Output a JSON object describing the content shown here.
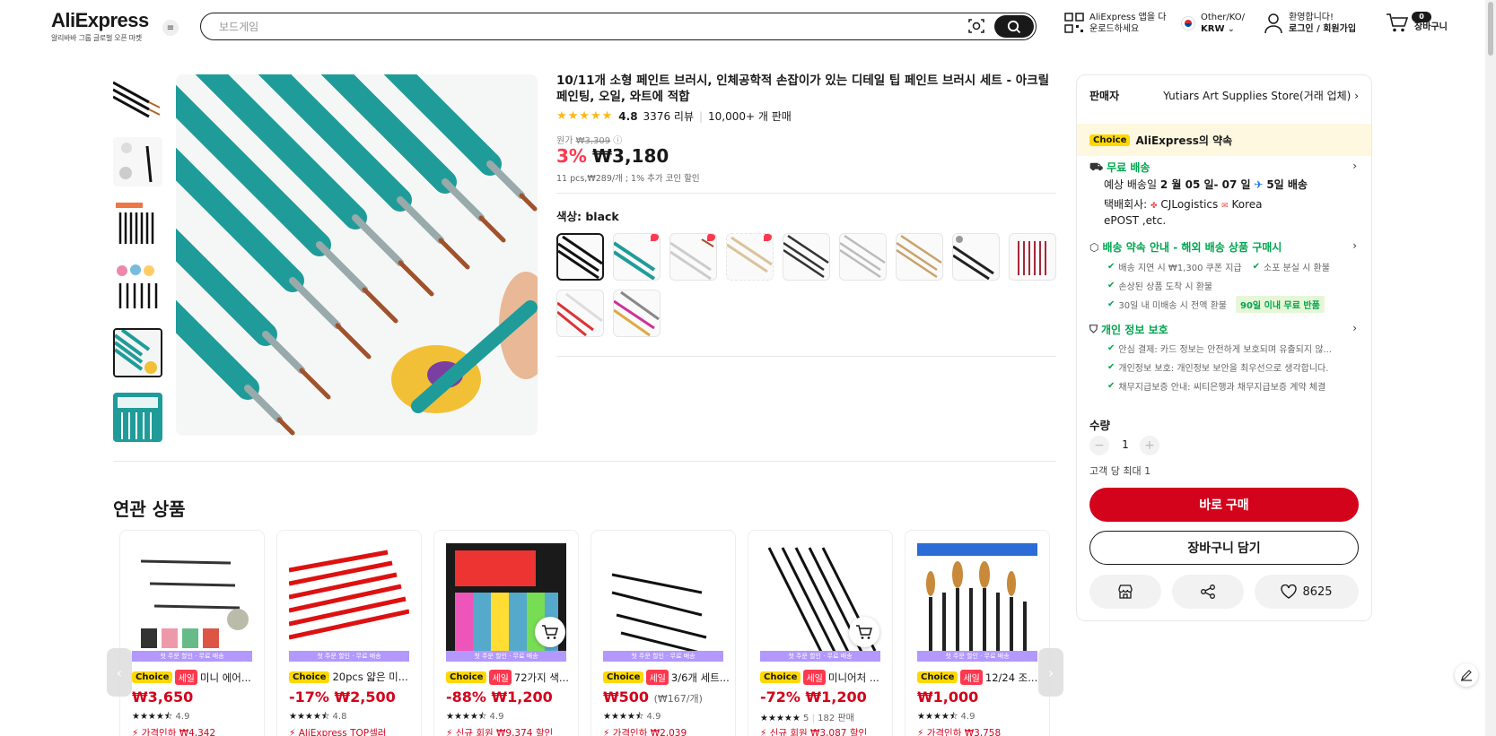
{
  "header": {
    "logo": "AliExpress",
    "logo_sub": "알리바바 그룹 글로벌 오픈 마켓",
    "search_placeholder": "보드게임",
    "app_download_line1": "AliExpress 앱을 다",
    "app_download_line2": "운로드하세요",
    "locale_line1": "Other/KO/",
    "locale_line2": "KRW",
    "account_line1": "환영합니다!",
    "account_line2": "로그인 / 회원가입",
    "cart_count": "0",
    "cart_label": "장바구니"
  },
  "product": {
    "title": "10/11개 소형 페인트 브러시, 인체공학적 손잡이가 있는 디테일 팁 페인트 브러시 세트 - 아크릴 페인팅, 오일, 와트에 적합",
    "rating": "4.8",
    "reviews": "3376 리뷰",
    "sold": "10,000+ 개 판매",
    "orig_label": "원가",
    "orig_price": "₩3,309",
    "discount": "3%",
    "price": "₩3,180",
    "unit_info": "11 pcs,₩289/개 ; 1% 추가 코인 할인",
    "color_label": "색상: black"
  },
  "side": {
    "seller_label": "판매자",
    "seller_name": "Yutiars Art Supplies Store(거래 업체)",
    "choice_tag": "Choice",
    "promise_label": "AliExpress의 약속",
    "free_shipping": "무료 배송",
    "delivery_prefix": "예상 배송일",
    "delivery_dates": "2 월 05 일- 07 일",
    "delivery_speed": "5일 배송",
    "courier_prefix": "택배회사:",
    "courier_1": "CJLogistics",
    "courier_2": "Korea",
    "courier_3": "ePOST ,etc.",
    "commitment_title": "배송 약속 안내 - 해외 배송 상품 구매시",
    "commitment_items": [
      "배송 지연 시 ₩1,300 쿠폰 지급",
      "소포 분실 시 환불",
      "손상된 상품 도착 시 환불",
      "30일 내 미배송 시 전액 환불"
    ],
    "return_tag": "90일 이내 무료 반품",
    "privacy_title": "개인 정보 보호",
    "privacy_items": [
      "안심 결제: 카드 정보는 안전하게 보호되며 유출되지 않...",
      "개인정보 보호: 개인정보 보안을 최우선으로 생각합니다.",
      "채무지급보증 안내: 씨티은행과 채무지급보증 계약 체결"
    ],
    "qty_label": "수량",
    "qty_value": "1",
    "max_per_customer": "고객 당 최대 1",
    "buy_now": "바로 구매",
    "add_to_cart": "장바구니 담기",
    "wishlist_count": "8625"
  },
  "related": {
    "title": "연관 상품",
    "strip_text": "첫 주문 할인 · 무료 배송",
    "items": [
      {
        "choice": "Choice",
        "sale": "세일",
        "name": "미니 에어...",
        "price": "₩3,650",
        "price_sub": "",
        "stars": "★★★★⯪",
        "rating": "4.9",
        "extra": "",
        "promo": "가격인하 ₩4,342"
      },
      {
        "choice": "Choice",
        "sale": "",
        "name": "20pcs 얇은 미...",
        "price": "-17% ₩2,500",
        "price_sub": "",
        "stars": "★★★★⯪",
        "rating": "4.8",
        "extra": "",
        "promo": "AliExpress TOP셀러"
      },
      {
        "choice": "Choice",
        "sale": "세일",
        "name": "72가지 색...",
        "price": "-88% ₩1,200",
        "price_sub": "",
        "stars": "★★★★⯪",
        "rating": "4.9",
        "extra": "",
        "promo": "신규 회원 ₩9,374 할인"
      },
      {
        "choice": "Choice",
        "sale": "세일",
        "name": "3/6개 세트...",
        "price": "₩500",
        "price_sub": "(₩167/개)",
        "stars": "★★★★⯪",
        "rating": "4.9",
        "extra": "",
        "promo": "가격인하 ₩2,039"
      },
      {
        "choice": "Choice",
        "sale": "세일",
        "name": "미니어처 ...",
        "price": "-72% ₩1,200",
        "price_sub": "",
        "stars": "★★★★★",
        "rating": "5",
        "extra": "182 판매",
        "promo": "신규 회원 ₩3,087 할인"
      },
      {
        "choice": "Choice",
        "sale": "세일",
        "name": "12/24 조...",
        "price": "₩1,000",
        "price_sub": "",
        "stars": "★★★★⯪",
        "rating": "4.9",
        "extra": "",
        "promo": "가격인하 ₩3,758"
      }
    ]
  },
  "colors": {
    "accent_red": "#d3031c",
    "discount_red": "#fd384f",
    "teal": "#1f9c9a",
    "green": "#00a64f",
    "choice_yellow": "#ffd800"
  }
}
